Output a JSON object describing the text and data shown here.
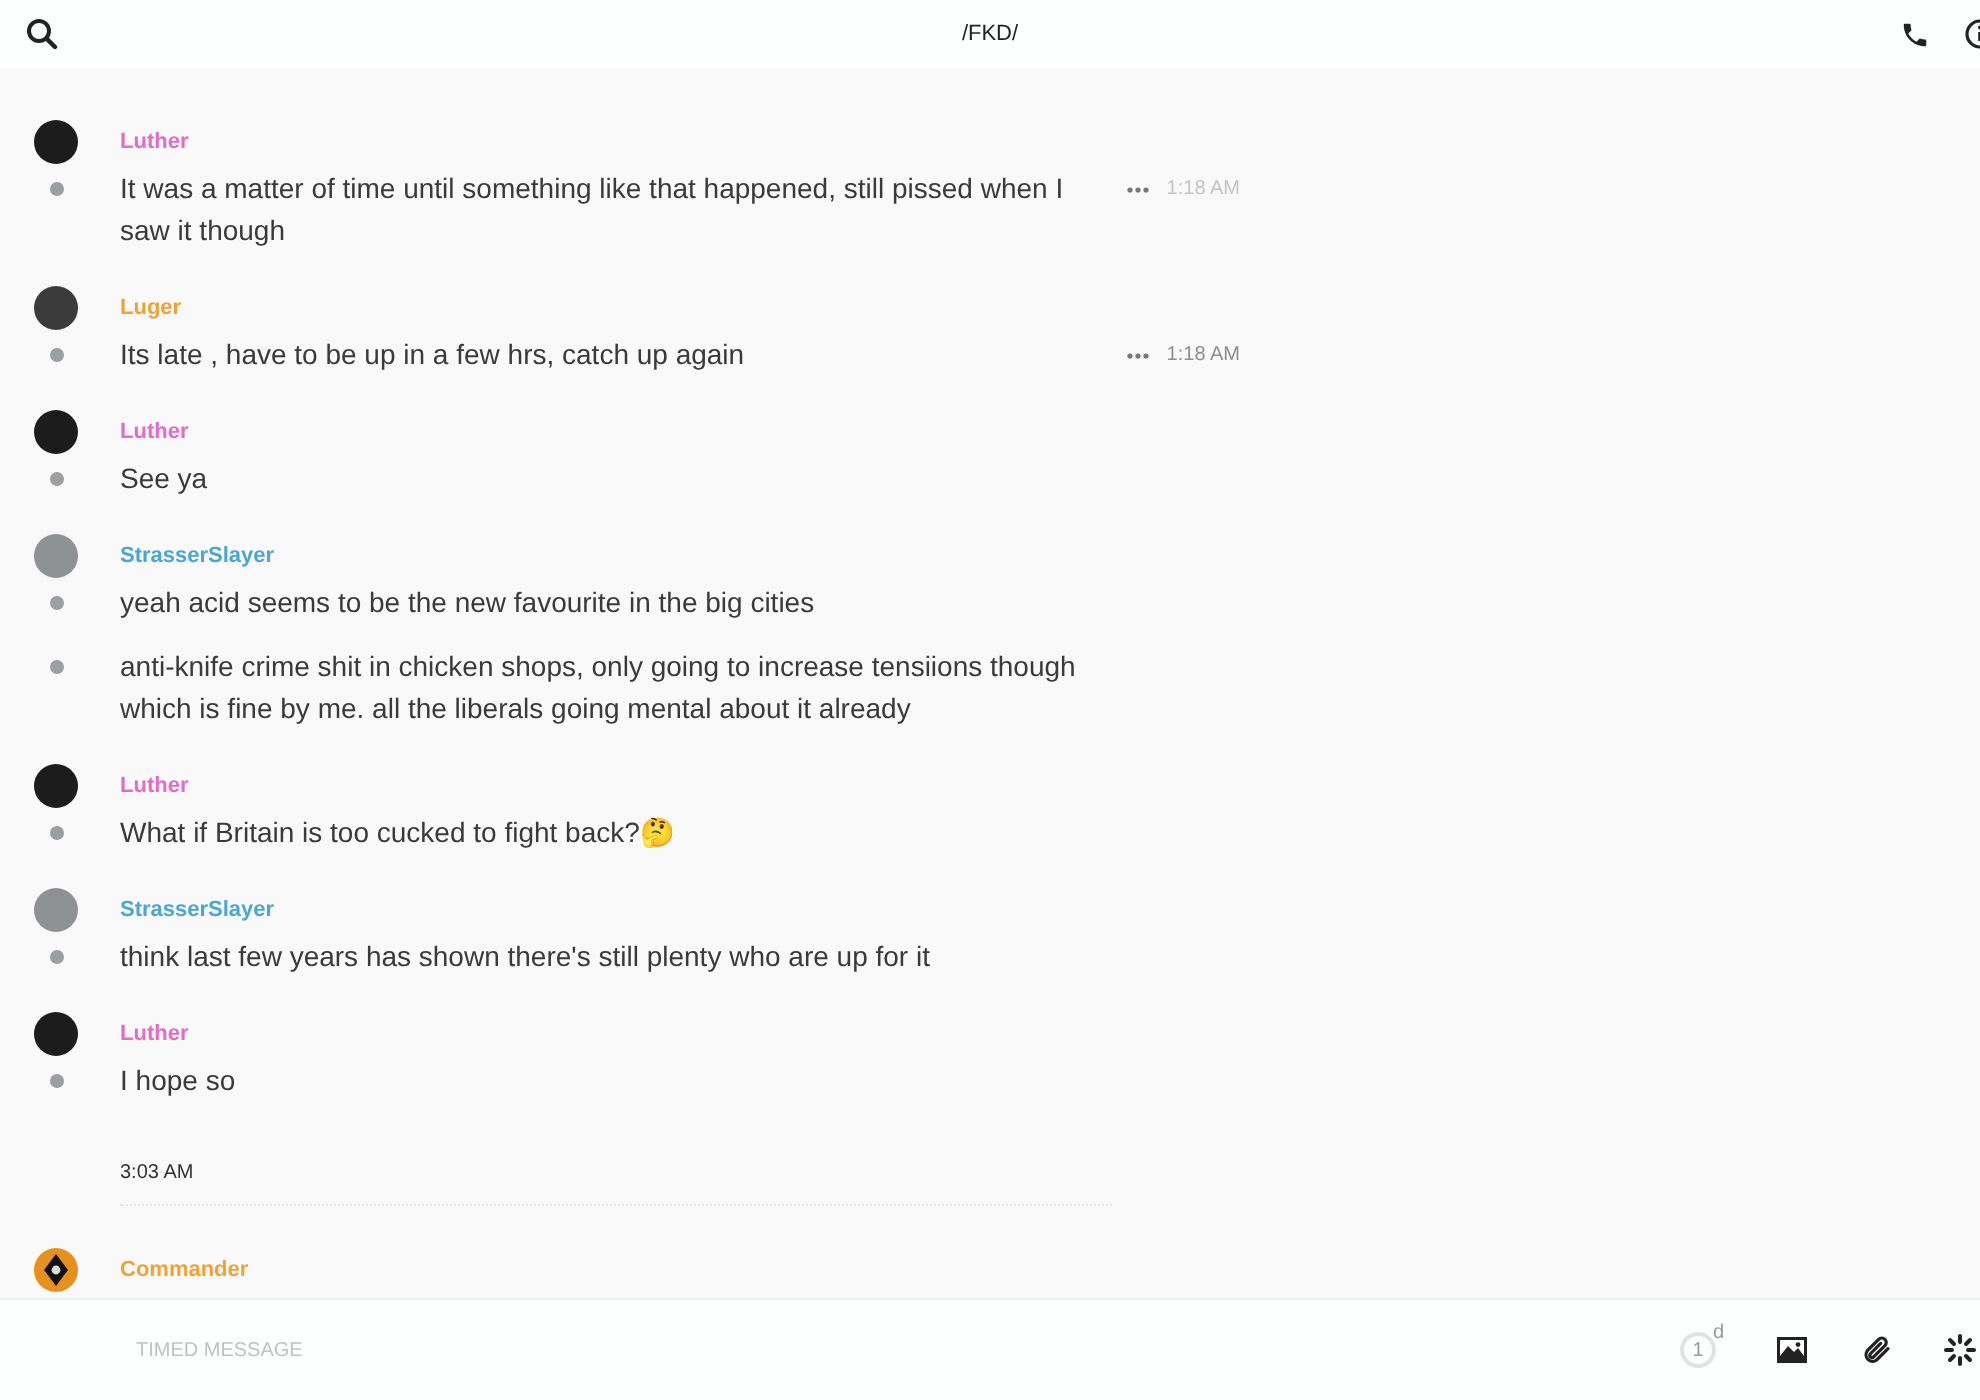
{
  "header": {
    "title": "/FKD/"
  },
  "groups": [
    {
      "author": "Luther",
      "color": "#e46bc8",
      "kind": "dark",
      "messages": [
        {
          "text": "It was a matter of time until something like that happened, still pissed when I saw it though",
          "time": "1:18 AM",
          "menu_visible": true,
          "faded": true
        }
      ]
    },
    {
      "author": "Luger",
      "color": "#eea23a",
      "kind": "photo",
      "messages": [
        {
          "text": "Its late , have to be up in a few hrs, catch up again",
          "time": "1:18 AM",
          "menu_visible": true,
          "faded": false
        }
      ]
    },
    {
      "author": "Luther",
      "color": "#e46bc8",
      "kind": "dark",
      "messages": [
        {
          "text": "See ya"
        }
      ]
    },
    {
      "author": "StrasserSlayer",
      "color": "#4ba6d6",
      "kind": "landscape",
      "messages": [
        {
          "text": "yeah acid seems to be the new favourite in the big cities"
        },
        {
          "text": "anti-knife crime shit in chicken shops, only going to increase tensiions though which is fine by me. all the liberals going mental about it already"
        }
      ]
    },
    {
      "author": "Luther",
      "color": "#e46bc8",
      "kind": "dark",
      "messages": [
        {
          "text": "What if Britain is too cucked to fight back?🤔"
        }
      ]
    },
    {
      "author": "StrasserSlayer",
      "color": "#4ba6d6",
      "kind": "landscape",
      "messages": [
        {
          "text": "think last few years has shown there's still plenty who are up for it"
        }
      ]
    },
    {
      "author": "Luther",
      "color": "#e46bc8",
      "kind": "dark",
      "messages": [
        {
          "text": "I hope so"
        }
      ]
    }
  ],
  "divider": {
    "label": "3:03 AM"
  },
  "after_divider": [
    {
      "author": "Commander",
      "color": "#eea23a",
      "kind": "diamond"
    }
  ],
  "composer": {
    "placeholder": "TIMED MESSAGE",
    "timer_value": "1",
    "timer_unit": "d"
  }
}
